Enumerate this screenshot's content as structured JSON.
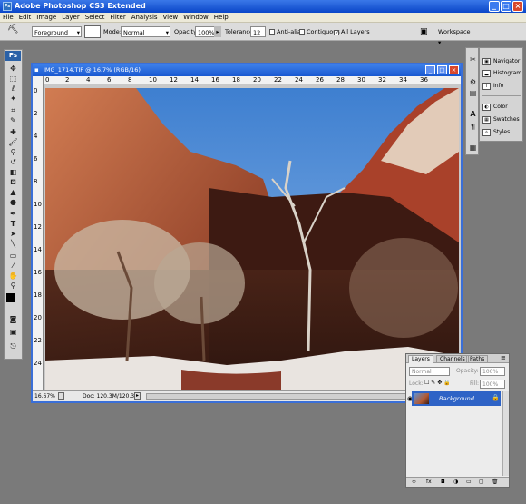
{
  "app": {
    "title": "Adobe Photoshop CS3 Extended"
  },
  "menu": [
    "File",
    "Edit",
    "Image",
    "Layer",
    "Select",
    "Filter",
    "Analysis",
    "View",
    "Window",
    "Help"
  ],
  "options": {
    "fill_source": "Foreground",
    "mode_label": "Mode:",
    "mode_value": "Normal",
    "opacity_label": "Opacity:",
    "opacity_value": "100%",
    "tolerance_label": "Tolerance:",
    "tolerance_value": "12",
    "anti_alias": "Anti-alias",
    "contiguous": "Contiguous",
    "all_layers": "All Layers",
    "all_layers_checked": true,
    "workspace": "Workspace"
  },
  "toolbox": {
    "logo": "Ps"
  },
  "document": {
    "title": "IMG_1714.TIF @ 16.7% (RGB/16)",
    "zoom": "16.67%",
    "doc_size": "Doc: 120.3M/120.3M",
    "ruler_top": [
      "0",
      "2",
      "4",
      "6",
      "8",
      "10",
      "12",
      "14",
      "16",
      "18",
      "20",
      "22",
      "24",
      "26",
      "28",
      "30",
      "32",
      "34",
      "36"
    ],
    "ruler_left": [
      "0",
      "2",
      "4",
      "6",
      "8",
      "10",
      "12",
      "14",
      "16",
      "18",
      "20",
      "22",
      "24"
    ]
  },
  "panels": {
    "group1": [
      "Navigator",
      "Histogram",
      "Info"
    ],
    "group2": [
      "Color",
      "Swatches",
      "Styles"
    ]
  },
  "layers": {
    "tabs": [
      "Layers",
      "Channels",
      "Paths"
    ],
    "blend": "Normal",
    "opacity_label": "Opacity:",
    "opacity": "100%",
    "lock_label": "Lock:",
    "fill_label": "Fill:",
    "fill": "100%",
    "layer_name": "Background"
  },
  "colors": {
    "sky": "#5a93d8",
    "rock": "#b35a34",
    "shadow": "#3a1c14"
  }
}
